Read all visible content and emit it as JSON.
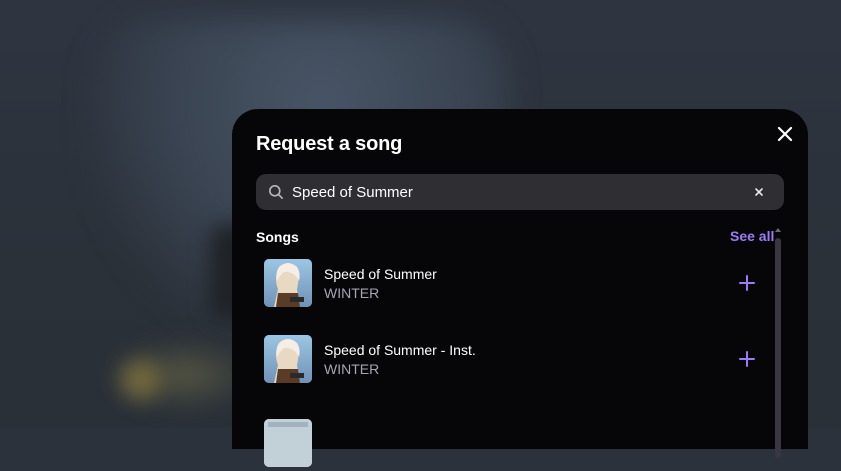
{
  "modal": {
    "title": "Request a song",
    "close_icon": "close-icon"
  },
  "search": {
    "value": "Speed of Summer",
    "placeholder": "Search",
    "icon": "search-icon",
    "clear_icon": "clear-icon"
  },
  "songs_section": {
    "title": "Songs",
    "see_all": "See all",
    "items": [
      {
        "title": "Speed of Summer",
        "artist": "WINTER",
        "cover_icon": "album-cover",
        "action_icon": "plus-icon"
      },
      {
        "title": "Speed of Summer - Inst.",
        "artist": "WINTER",
        "cover_icon": "album-cover",
        "action_icon": "plus-icon"
      },
      {
        "title": "",
        "artist": "",
        "cover_icon": "album-cover",
        "action_icon": ""
      }
    ]
  },
  "colors": {
    "accent": "#9b7cf4",
    "modal_bg": "#060608",
    "search_bg": "#2f2f33",
    "artist_text": "#a7a3b6"
  }
}
